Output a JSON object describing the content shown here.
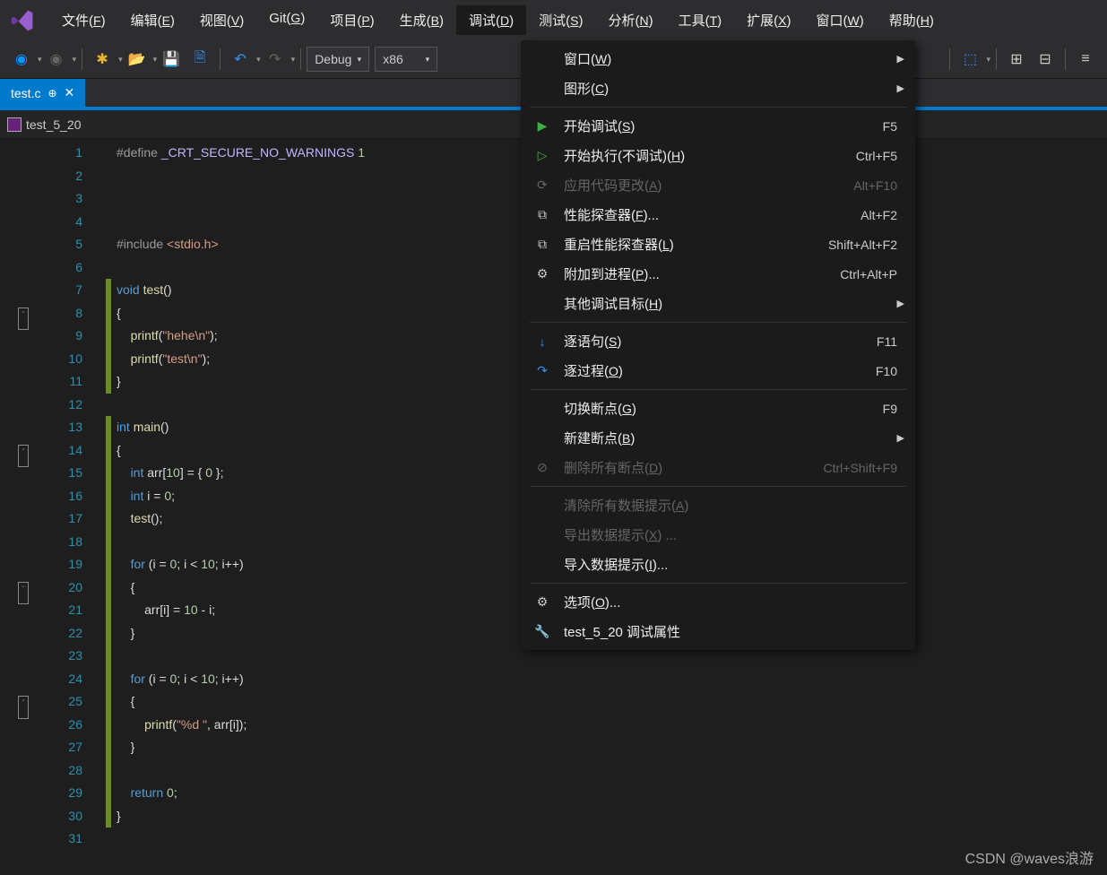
{
  "menubar": {
    "items": [
      {
        "pre": "文件(",
        "u": "F",
        "post": ")"
      },
      {
        "pre": "编辑(",
        "u": "E",
        "post": ")"
      },
      {
        "pre": "视图(",
        "u": "V",
        "post": ")"
      },
      {
        "pre": "Git(",
        "u": "G",
        "post": ")"
      },
      {
        "pre": "项目(",
        "u": "P",
        "post": ")"
      },
      {
        "pre": "生成(",
        "u": "B",
        "post": ")"
      },
      {
        "pre": "调试(",
        "u": "D",
        "post": ")"
      },
      {
        "pre": "测试(",
        "u": "S",
        "post": ")"
      },
      {
        "pre": "分析(",
        "u": "N",
        "post": ")"
      },
      {
        "pre": "工具(",
        "u": "T",
        "post": ")"
      },
      {
        "pre": "扩展(",
        "u": "X",
        "post": ")"
      },
      {
        "pre": "窗口(",
        "u": "W",
        "post": ")"
      },
      {
        "pre": "帮助(",
        "u": "H",
        "post": ")"
      }
    ]
  },
  "toolbar": {
    "config": "Debug",
    "platform": "x86"
  },
  "tab": {
    "name": "test.c"
  },
  "navbar": {
    "context": "test_5_20"
  },
  "code": {
    "lines": [
      {
        "n": 1,
        "html": "<span class='inc'>#define</span> <span class='mac'>_CRT_SECURE_NO_WARNINGS</span> <span class='num'>1</span>"
      },
      {
        "n": 2,
        "html": ""
      },
      {
        "n": 3,
        "html": ""
      },
      {
        "n": 4,
        "html": ""
      },
      {
        "n": 5,
        "html": "<span class='inc'>#include</span> <span class='str'>&lt;stdio.h&gt;</span>"
      },
      {
        "n": 6,
        "html": ""
      },
      {
        "n": 7,
        "bar": true,
        "fold": "-",
        "html": "<span class='kw'>void</span> <span class='fn'>test</span><span class='t'>()</span>"
      },
      {
        "n": 8,
        "bar": true,
        "html": "<span class='t'>{</span>"
      },
      {
        "n": 9,
        "bar": true,
        "html": "    <span class='fn'>printf</span><span class='t'>(</span><span class='str'>\"hehe\\n\"</span><span class='t'>);</span>"
      },
      {
        "n": 10,
        "bar": true,
        "html": "    <span class='fn'>printf</span><span class='t'>(</span><span class='str'>\"test\\n\"</span><span class='t'>);</span>"
      },
      {
        "n": 11,
        "bar": true,
        "html": "<span class='t'>}</span>"
      },
      {
        "n": 12,
        "html": ""
      },
      {
        "n": 13,
        "bar": true,
        "fold": "-",
        "html": "<span class='kw'>int</span> <span class='fn'>main</span><span class='t'>()</span>"
      },
      {
        "n": 14,
        "bar": true,
        "html": "<span class='t'>{</span>"
      },
      {
        "n": 15,
        "bar": true,
        "html": "    <span class='kw'>int</span> <span class='t'>arr[</span><span class='num'>10</span><span class='t'>] = { </span><span class='num'>0</span><span class='t'> };</span>"
      },
      {
        "n": 16,
        "bar": true,
        "html": "    <span class='kw'>int</span> <span class='t'>i = </span><span class='num'>0</span><span class='t'>;</span>"
      },
      {
        "n": 17,
        "bar": true,
        "html": "    <span class='fn'>test</span><span class='t'>();</span>"
      },
      {
        "n": 18,
        "bar": true,
        "html": ""
      },
      {
        "n": 19,
        "bar": true,
        "fold": "-",
        "html": "    <span class='kw'>for</span> <span class='t'>(i = </span><span class='num'>0</span><span class='t'>; i &lt; </span><span class='num'>10</span><span class='t'>; i++)</span>"
      },
      {
        "n": 20,
        "bar": true,
        "html": "    <span class='t'>{</span>"
      },
      {
        "n": 21,
        "bar": true,
        "html": "        <span class='t'>arr[i] = </span><span class='num'>10</span><span class='t'> - i;</span>"
      },
      {
        "n": 22,
        "bar": true,
        "html": "    <span class='t'>}</span>"
      },
      {
        "n": 23,
        "bar": true,
        "html": ""
      },
      {
        "n": 24,
        "bar": true,
        "fold": "-",
        "html": "    <span class='kw'>for</span> <span class='t'>(i = </span><span class='num'>0</span><span class='t'>; i &lt; </span><span class='num'>10</span><span class='t'>; i++)</span>"
      },
      {
        "n": 25,
        "bar": true,
        "html": "    <span class='t'>{</span>"
      },
      {
        "n": 26,
        "bar": true,
        "html": "        <span class='fn'>printf</span><span class='t'>(</span><span class='str'>\"%d \"</span><span class='t'>, arr[i]);</span>"
      },
      {
        "n": 27,
        "bar": true,
        "html": "    <span class='t'>}</span>"
      },
      {
        "n": 28,
        "bar": true,
        "html": ""
      },
      {
        "n": 29,
        "bar": true,
        "html": "    <span class='kw'>return</span> <span class='num'>0</span><span class='t'>;</span>"
      },
      {
        "n": 30,
        "bar": true,
        "html": "<span class='t'>}</span>"
      },
      {
        "n": 31,
        "html": ""
      }
    ]
  },
  "dropdown": {
    "groups": [
      [
        {
          "icon": "",
          "pre": "窗口(",
          "u": "W",
          "post": ")",
          "sc": "",
          "arrow": true
        },
        {
          "icon": "",
          "pre": "图形(",
          "u": "C",
          "post": ")",
          "sc": "",
          "arrow": true
        }
      ],
      [
        {
          "icon": "▶",
          "iconColor": "#3cb043",
          "pre": "开始调试(",
          "u": "S",
          "post": ")",
          "sc": "F5",
          "red": true
        },
        {
          "icon": "▷",
          "iconColor": "#3cb043",
          "pre": "开始执行(不调试)(",
          "u": "H",
          "post": ")",
          "sc": "Ctrl+F5",
          "red": true
        },
        {
          "icon": "⟳",
          "pre": "应用代码更改(",
          "u": "A",
          "post": ")",
          "sc": "Alt+F10",
          "disabled": true
        },
        {
          "icon": "⧉",
          "pre": "性能探查器(",
          "u": "F",
          "post": ")...",
          "sc": "Alt+F2"
        },
        {
          "icon": "⧉",
          "pre": "重启性能探查器(",
          "u": "L",
          "post": ")",
          "sc": "Shift+Alt+F2"
        },
        {
          "icon": "⚙",
          "pre": "附加到进程(",
          "u": "P",
          "post": ")...",
          "sc": "Ctrl+Alt+P"
        },
        {
          "icon": "",
          "pre": "其他调试目标(",
          "u": "H",
          "post": ")",
          "sc": "",
          "arrow": true
        }
      ],
      [
        {
          "icon": "↓",
          "iconColor": "#3794ff",
          "pre": "逐语句(",
          "u": "S",
          "post": ")",
          "sc": "F11",
          "red": true
        },
        {
          "icon": "↷",
          "iconColor": "#3794ff",
          "pre": "逐过程(",
          "u": "O",
          "post": ")",
          "sc": "F10",
          "red": true
        }
      ],
      [
        {
          "icon": "",
          "pre": "切换断点(",
          "u": "G",
          "post": ")",
          "sc": "F9",
          "red": true
        },
        {
          "icon": "",
          "pre": "新建断点(",
          "u": "B",
          "post": ")",
          "sc": "",
          "arrow": true,
          "red": true
        },
        {
          "icon": "⊘",
          "pre": "删除所有断点(",
          "u": "D",
          "post": ")",
          "sc": "Ctrl+Shift+F9",
          "disabled": true
        }
      ],
      [
        {
          "icon": "",
          "pre": "清除所有数据提示(",
          "u": "A",
          "post": ")",
          "sc": "",
          "disabled": true
        },
        {
          "icon": "",
          "pre": "导出数据提示(",
          "u": "X",
          "post": ") ...",
          "sc": "",
          "disabled": true
        },
        {
          "icon": "",
          "pre": "导入数据提示(",
          "u": "I",
          "post": ")...",
          "sc": ""
        }
      ],
      [
        {
          "icon": "⚙",
          "pre": "选项(",
          "u": "O",
          "post": ")...",
          "sc": ""
        },
        {
          "icon": "🔧",
          "pre": "test_5_20 调试属性",
          "u": "",
          "post": "",
          "sc": ""
        }
      ]
    ]
  },
  "watermark": "CSDN @waves浪游"
}
